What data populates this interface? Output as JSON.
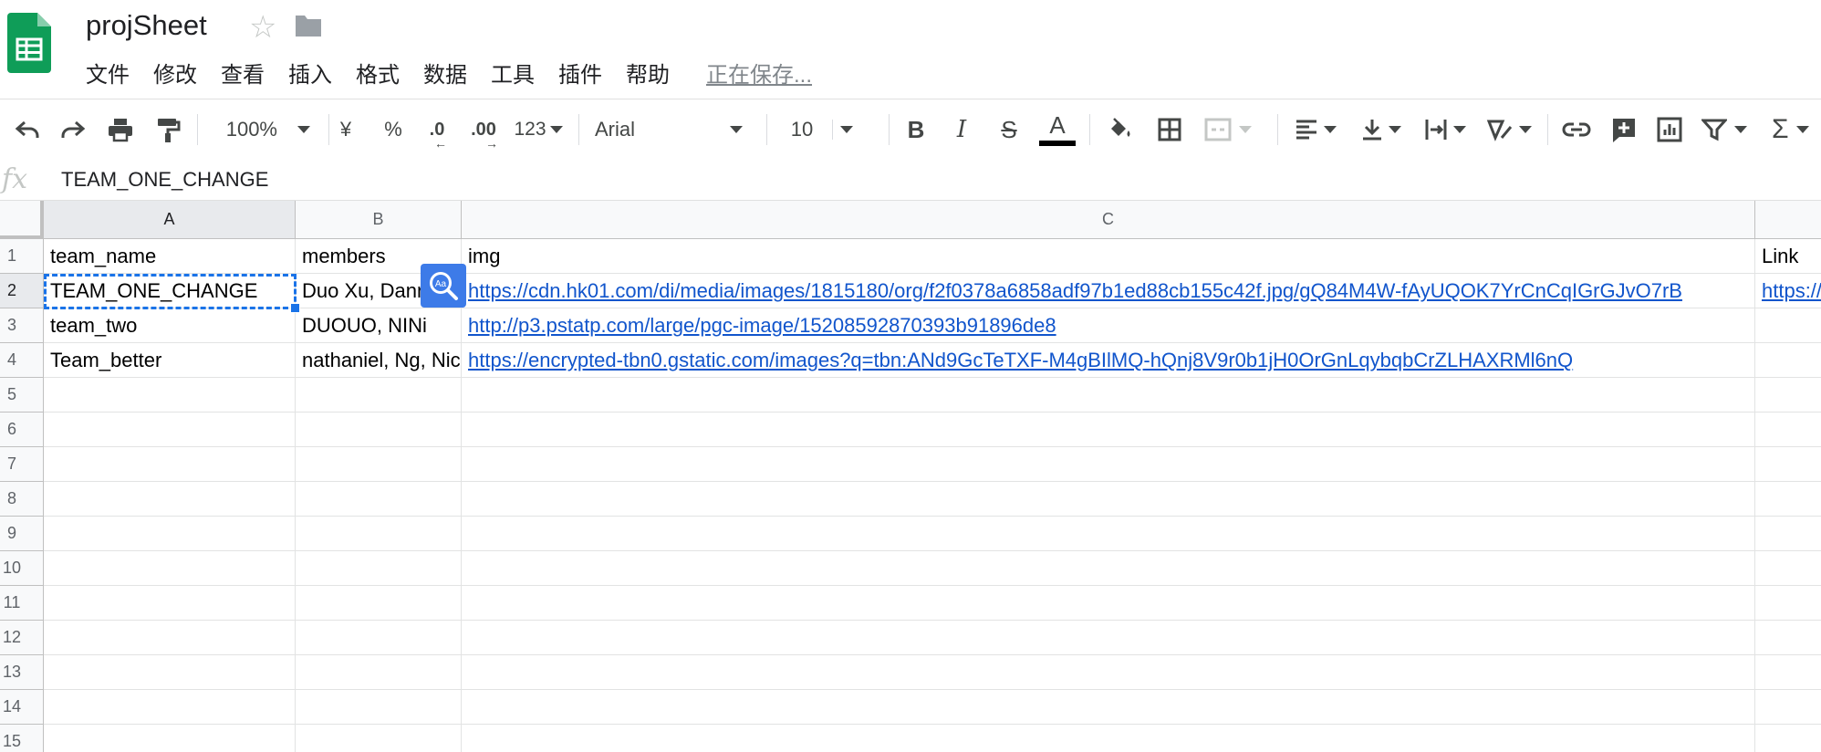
{
  "doc": {
    "title": "projSheet"
  },
  "menu": [
    "文件",
    "修改",
    "查看",
    "插入",
    "格式",
    "数据",
    "工具",
    "插件",
    "帮助"
  ],
  "saving_status": "正在保存...",
  "toolbar": {
    "zoom": "100%",
    "currency": "¥",
    "percent": "%",
    "decrease_decimal": ".0",
    "increase_decimal": ".00",
    "more_formats": "123",
    "font": "Arial",
    "font_size": "10",
    "text_color": "#000000",
    "icons": [
      "undo-icon",
      "redo-icon",
      "print-icon",
      "paint-format-icon",
      "bold-icon",
      "italic-icon",
      "strikethrough-icon",
      "text-color-icon",
      "fill-color-icon",
      "borders-icon",
      "merge-cells-icon",
      "align-icon",
      "valign-icon",
      "wrap-icon",
      "rotate-icon",
      "link-icon",
      "comment-icon",
      "chart-icon",
      "filter-icon",
      "functions-icon"
    ]
  },
  "formula_bar": {
    "fx": "fx",
    "value": "TEAM_ONE_CHANGE"
  },
  "columns": [
    "A",
    "B",
    "C"
  ],
  "rows": [
    "1",
    "2",
    "3",
    "4",
    "5",
    "6",
    "7",
    "8",
    "9",
    "10",
    "11",
    "12",
    "13",
    "14",
    "15"
  ],
  "cells": {
    "A1": "team_name",
    "B1": "members",
    "C1": "img",
    "D1": "Link",
    "A2": "TEAM_ONE_CHANGE",
    "B2": "Duo Xu, Danny",
    "C2": "https://cdn.hk01.com/di/media/images/1815180/org/f2f0378a6858adf97b1ed88cb155c42f.jpg/gQ84M4W-fAyUQOK7YrCnCqIGrGJvO7rB",
    "D2": "https://",
    "A3": "team_two",
    "B3": "DUOUO, NINi",
    "C3": "http://p3.pstatp.com/large/pgc-image/15208592870393b91896de8",
    "A4": "Team_better",
    "B4": "nathaniel, Ng, Nick",
    "C4": "https://encrypted-tbn0.gstatic.com/images?q=tbn:ANd9GcTeTXF-M4gBIlMQ-hQnj8V9r0b1jH0OrGnLqybqbCrZLHAXRMl6nQ"
  },
  "colors": {
    "accent": "#1a73e8",
    "link": "#1155cc",
    "logo": "#0f9d58"
  }
}
